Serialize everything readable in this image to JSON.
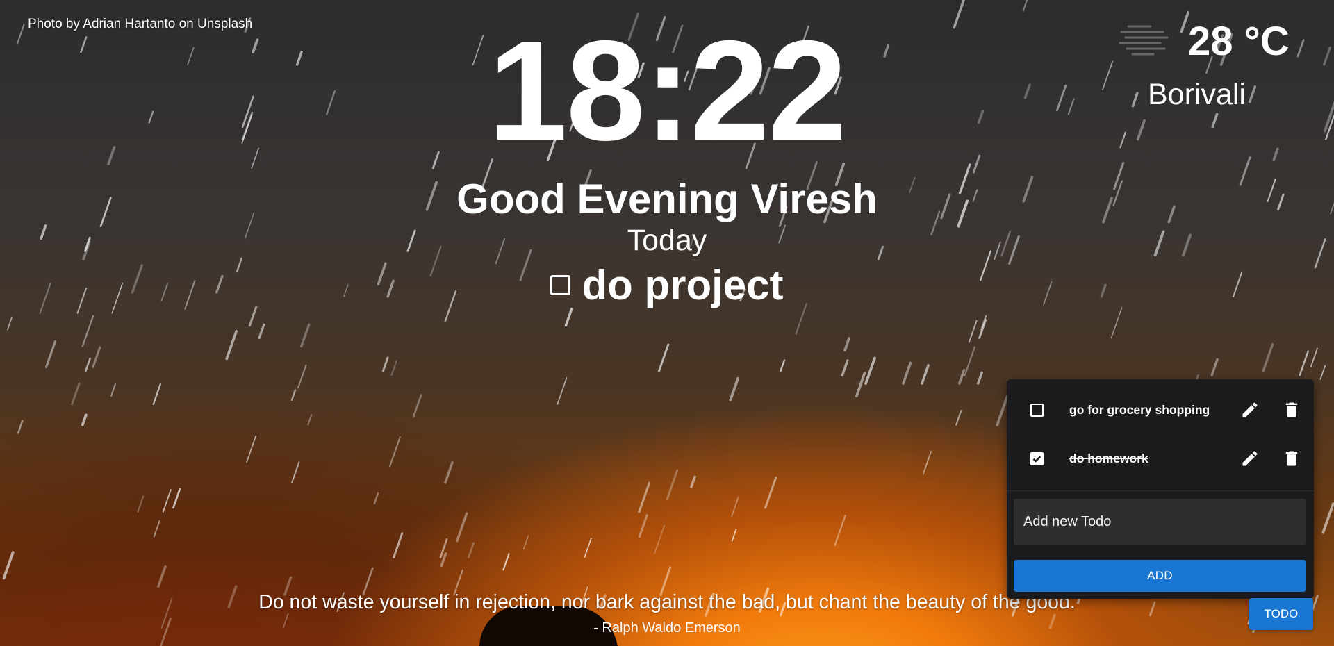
{
  "background": {
    "credit": "Photo by Adrian Hartanto on Unsplash"
  },
  "clock": {
    "time": "18:22"
  },
  "greeting": "Good Evening Viresh",
  "focus": {
    "label": "Today",
    "task": "do project",
    "checked": false
  },
  "weather": {
    "icon": "fog-icon",
    "temperature": "28 °C",
    "city": "Borivali"
  },
  "quote": {
    "text": "Do not waste yourself in rejection, nor bark against the bad, but chant the beauty of the good.",
    "author": "- Ralph Waldo Emerson"
  },
  "todo": {
    "items": [
      {
        "text": "go for grocery shopping",
        "done": false
      },
      {
        "text": "do homework",
        "done": true
      }
    ],
    "input_placeholder": "Add new Todo",
    "add_label": "ADD",
    "toggle_label": "TODO"
  },
  "colors": {
    "panel_bg": "#1c1c1e",
    "input_bg": "#2e2e30",
    "accent": "#1976d2"
  }
}
